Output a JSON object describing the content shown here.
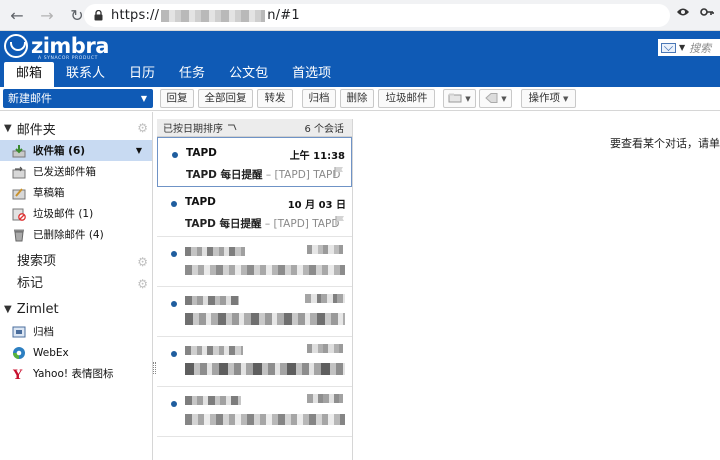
{
  "browser": {
    "url_prefix": "https://",
    "url_suffix": "n/#1"
  },
  "header": {
    "logo_text": "zimbra",
    "logo_sub": "A SYNACOR PRODUCT",
    "search_placeholder": "搜索"
  },
  "tabs": [
    "邮箱",
    "联系人",
    "日历",
    "任务",
    "公文包",
    "首选项"
  ],
  "toolbar": {
    "new_mail": "新建邮件",
    "reply": "回复",
    "reply_all": "全部回复",
    "forward": "转发",
    "archive": "归档",
    "delete": "删除",
    "spam": "垃圾邮件",
    "actions": "操作项"
  },
  "sidebar": {
    "mail_folders_title": "邮件夹",
    "folders": [
      {
        "label": "收件箱 (6)",
        "icon": "inbox-icon"
      },
      {
        "label": "已发送邮件箱",
        "icon": "sent-icon"
      },
      {
        "label": "草稿箱",
        "icon": "drafts-icon"
      },
      {
        "label": "垃圾邮件 (1)",
        "icon": "junk-icon"
      },
      {
        "label": "已删除邮件 (4)",
        "icon": "trash-icon"
      }
    ],
    "searches_title": "搜索项",
    "tags_title": "标记",
    "zimlets_title": "Zimlet",
    "zimlets": [
      {
        "label": "归档",
        "icon": "archive-icon"
      },
      {
        "label": "WebEx",
        "icon": "webex-icon"
      },
      {
        "label": "Yahoo! 表情图标",
        "icon": "yahoo-icon"
      }
    ]
  },
  "list": {
    "sort_label": "已按日期排序",
    "count_label": "6 个会话",
    "messages": [
      {
        "sender": "TAPD",
        "date": "上午 11:38",
        "subject": "TAPD 每日提醒",
        "fragment": "– [TAPD] TAPD",
        "selected": true
      },
      {
        "sender": "TAPD",
        "date": "10 月 03 日",
        "subject": "TAPD 每日提醒",
        "fragment": "– [TAPD] TAPD",
        "selected": false
      }
    ]
  },
  "reading": {
    "message": "要查看某个对话，请单"
  },
  "colors": {
    "brand_blue": "#0f5ab5",
    "selected_folder": "#c8daf2",
    "unread_dot": "#1f5d9e"
  }
}
